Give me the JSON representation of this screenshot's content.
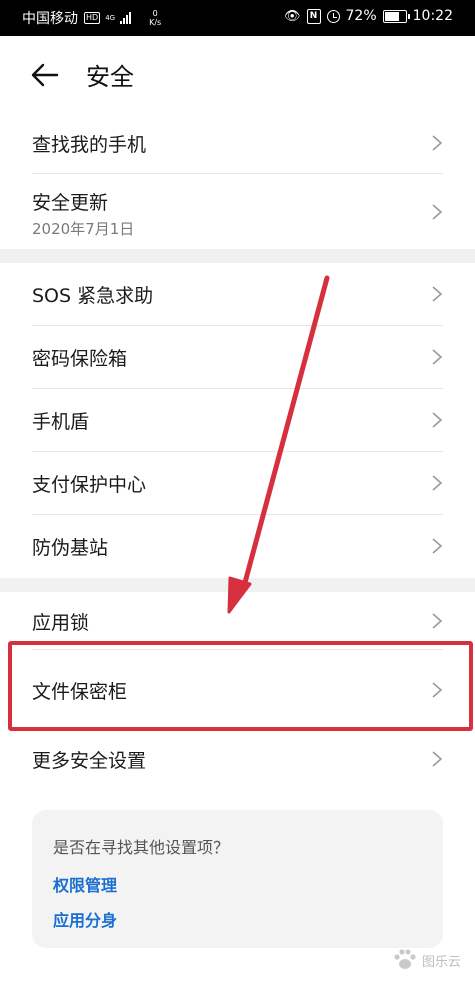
{
  "status_bar": {
    "carrier": "中国移动",
    "hd": "HD",
    "network": "4G",
    "net_speed_value": "0",
    "net_speed_unit": "K/s",
    "battery": "72%",
    "time": "10:22"
  },
  "header": {
    "title": "安全"
  },
  "groups": [
    [
      {
        "label": "查找我的手机"
      },
      {
        "label": "安全更新",
        "sub": "2020年7月1日"
      }
    ],
    [
      {
        "label": "SOS 紧急求助"
      },
      {
        "label": "密码保险箱"
      },
      {
        "label": "手机盾"
      },
      {
        "label": "支付保护中心"
      },
      {
        "label": "防伪基站"
      }
    ],
    [
      {
        "label": "应用锁"
      },
      {
        "label": "文件保密柜"
      },
      {
        "label": "更多安全设置"
      }
    ]
  ],
  "suggest": {
    "question": "是否在寻找其他设置项？",
    "links": [
      "权限管理",
      "应用分身"
    ]
  },
  "watermark": {
    "text": "图乐云"
  },
  "colors": {
    "annotation_red": "#d6303f",
    "link_blue": "#1a6fd1",
    "status_bar_bg": "#000000",
    "group_gap_bg": "#f1f1f1",
    "card_bg": "#f3f3f3"
  }
}
